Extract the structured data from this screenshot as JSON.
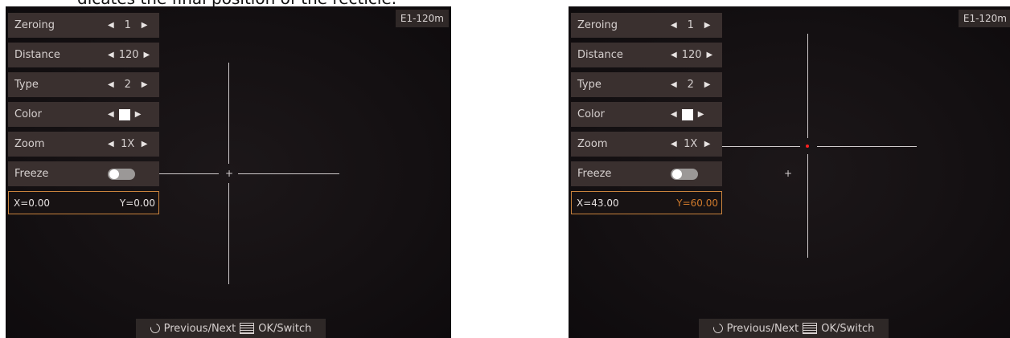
{
  "caption_fragment": "dicates the final position of the recticle.",
  "panels": [
    {
      "profile": "E1-120m",
      "menu": {
        "zeroing": {
          "label": "Zeroing",
          "value": "1"
        },
        "distance": {
          "label": "Distance",
          "value": "120"
        },
        "type": {
          "label": "Type",
          "value": "2"
        },
        "color": {
          "label": "Color",
          "swatch": "#ffffff"
        },
        "zoom": {
          "label": "Zoom",
          "value": "1X"
        },
        "freeze": {
          "label": "Freeze",
          "state": "off"
        }
      },
      "coords": {
        "x": "X=0.00",
        "y": "Y=0.00",
        "y_highlighted": false
      },
      "footer": {
        "prev_next": "Previous/Next",
        "ok_switch": "OK/Switch"
      }
    },
    {
      "profile": "E1-120m",
      "menu": {
        "zeroing": {
          "label": "Zeroing",
          "value": "1"
        },
        "distance": {
          "label": "Distance",
          "value": "120"
        },
        "type": {
          "label": "Type",
          "value": "2"
        },
        "color": {
          "label": "Color",
          "swatch": "#ffffff"
        },
        "zoom": {
          "label": "Zoom",
          "value": "1X"
        },
        "freeze": {
          "label": "Freeze",
          "state": "off"
        }
      },
      "coords": {
        "x": "X=43.00",
        "y": "Y=60.00",
        "y_highlighted": true
      },
      "footer": {
        "prev_next": "Previous/Next",
        "ok_switch": "OK/Switch"
      }
    }
  ],
  "colors": {
    "highlight": "#d07a2c",
    "reticle_dot": "#ff2020"
  },
  "icons": {
    "arrow_left": "arrow-left-icon",
    "arrow_right": "arrow-right-icon",
    "prev_next": "rotate-icon",
    "ok": "list-icon"
  }
}
